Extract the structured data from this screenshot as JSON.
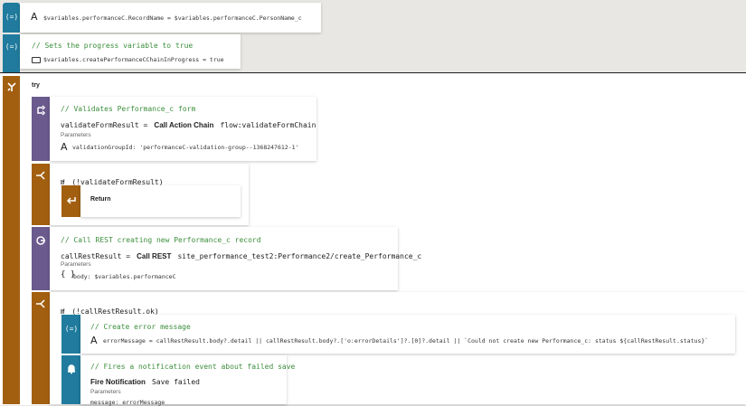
{
  "colors": {
    "assign": "#207b9e",
    "action_chain": "#6a5a8d",
    "branch": "#a25f10",
    "canvas": "#e9e7e4"
  },
  "nodes": {
    "assign1": {
      "icon": "assign-icon",
      "line_glyph": "A",
      "expression": "$variables.performanceC.RecordName = $variables.performanceC.PersonName_c"
    },
    "assign2": {
      "icon": "assign-icon",
      "comment": "// Sets the progress variable to true",
      "line_glyph": "▭",
      "expression": "$variables.createPerformanceCChainInProgress = true"
    },
    "try": {
      "icon": "try-icon",
      "label": "try"
    },
    "call_chain": {
      "icon": "call-chain-icon",
      "comment": "// Validates Performance_c form",
      "assign_prefix": "validateFormResult =",
      "action": "Call Action Chain",
      "target": "flow:validateFormChain",
      "params_label": "Parameters",
      "param_glyph": "A",
      "param": "validationGroupId: 'performanceC-validation-group--1368247612-1'"
    },
    "if1": {
      "icon": "if-icon",
      "label": "If",
      "condition": "(!validateFormResult)"
    },
    "return": {
      "icon": "return-icon",
      "label": "Return"
    },
    "call_rest": {
      "icon": "rest-icon",
      "comment": "// Call REST creating new Performance_c record",
      "assign_prefix": "callRestResult =",
      "action": "Call REST",
      "target": "site_performance_test2:Performance2/create_Performance_c",
      "params_label": "Parameters",
      "param_glyph": "{ }",
      "param": "body: $variables.performanceC"
    },
    "if2": {
      "icon": "if-icon",
      "label": "If",
      "condition": "(!callRestResult.ok)"
    },
    "assign3": {
      "icon": "assign-icon",
      "comment": "// Create error message",
      "line_glyph": "A",
      "expression": "errorMessage = callRestResult.body?.detail || callRestResult.body?.['o:errorDetails']?.[0]?.detail || `Could not create new Performance_c: status ${callRestResult.status}`"
    },
    "notify": {
      "icon": "bell-icon",
      "comment": "// Fires a notification event about failed save",
      "action": "Fire Notification",
      "value": "Save failed",
      "params_label": "Parameters",
      "param": "message: errorMessage"
    }
  }
}
